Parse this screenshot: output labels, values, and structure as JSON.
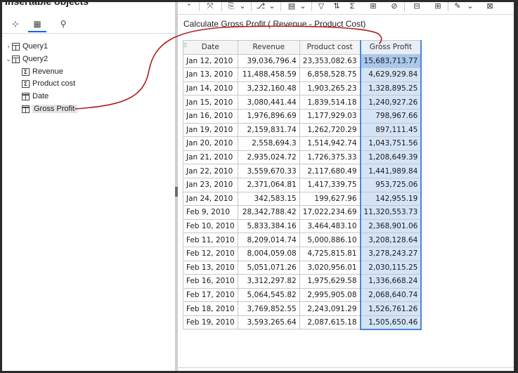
{
  "left_panel": {
    "title": "Insertable objects",
    "tabs": [
      {
        "icon": "source-tree-icon",
        "glyph": "⊹"
      },
      {
        "icon": "data-items-icon",
        "glyph": "▦"
      },
      {
        "icon": "toolbox-icon",
        "glyph": "⚲"
      }
    ],
    "tree": {
      "query1": "Query1",
      "query2": "Query2",
      "items": [
        "Revenue",
        "Product cost",
        "Date",
        "Gross Profit"
      ]
    }
  },
  "toolbar": {
    "buttons": [
      "⁺",
      "⤧",
      "⎘",
      "⌄",
      "⎇",
      "⌄",
      "▤",
      "⌄",
      "▽",
      "⇅",
      "Σ",
      "⊞",
      "⊘",
      "⊟",
      "⊞",
      "✎",
      "⌄",
      "⊠"
    ]
  },
  "report": {
    "title": "Calculate Gross Profit ( Revenue - Product Cost)",
    "columns": [
      "Date",
      "Revenue",
      "Product cost",
      "Gross Profit"
    ],
    "rows": [
      [
        "Jan 12, 2010",
        "39,036,796.4",
        "23,353,082.63",
        "15,683,713.77"
      ],
      [
        "Jan 13, 2010",
        "11,488,458.59",
        "6,858,528.75",
        "4,629,929.84"
      ],
      [
        "Jan 14, 2010",
        "3,232,160.48",
        "1,903,265.23",
        "1,328,895.25"
      ],
      [
        "Jan 15, 2010",
        "3,080,441.44",
        "1,839,514.18",
        "1,240,927.26"
      ],
      [
        "Jan 16, 2010",
        "1,976,896.69",
        "1,177,929.03",
        "798,967.66"
      ],
      [
        "Jan 19, 2010",
        "2,159,831.74",
        "1,262,720.29",
        "897,111.45"
      ],
      [
        "Jan 20, 2010",
        "2,558,694.3",
        "1,514,942.74",
        "1,043,751.56"
      ],
      [
        "Jan 21, 2010",
        "2,935,024.72",
        "1,726,375.33",
        "1,208,649.39"
      ],
      [
        "Jan 22, 2010",
        "3,559,670.33",
        "2,117,680.49",
        "1,441,989.84"
      ],
      [
        "Jan 23, 2010",
        "2,371,064.81",
        "1,417,339.75",
        "953,725.06"
      ],
      [
        "Jan 24, 2010",
        "342,583.15",
        "199,627.96",
        "142,955.19"
      ],
      [
        "Feb 9, 2010",
        "28,342,788.42",
        "17,022,234.69",
        "11,320,553.73"
      ],
      [
        "Feb 10, 2010",
        "5,833,384.16",
        "3,464,483.10",
        "2,368,901.06"
      ],
      [
        "Feb 11, 2010",
        "8,209,014.74",
        "5,000,886.10",
        "3,208,128.64"
      ],
      [
        "Feb 12, 2010",
        "8,004,059.08",
        "4,725,815.81",
        "3,278,243.27"
      ],
      [
        "Feb 13, 2010",
        "5,051,071.26",
        "3,020,956.01",
        "2,030,115.25"
      ],
      [
        "Feb 16, 2010",
        "3,312,297.82",
        "1,975,629.58",
        "1,336,668.24"
      ],
      [
        "Feb 17, 2010",
        "5,064,545.82",
        "2,995,905.08",
        "2,068,640.74"
      ],
      [
        "Feb 18, 2010",
        "3,769,852.55",
        "2,243,091.29",
        "1,526,761.26"
      ],
      [
        "Feb 19, 2010",
        "3,593,265.64",
        "2,087,615.18",
        "1,505,650.46"
      ]
    ]
  },
  "colors": {
    "accent": "#0f62fe",
    "selection": "#4b86d6",
    "annotation": "#b01c1c"
  }
}
